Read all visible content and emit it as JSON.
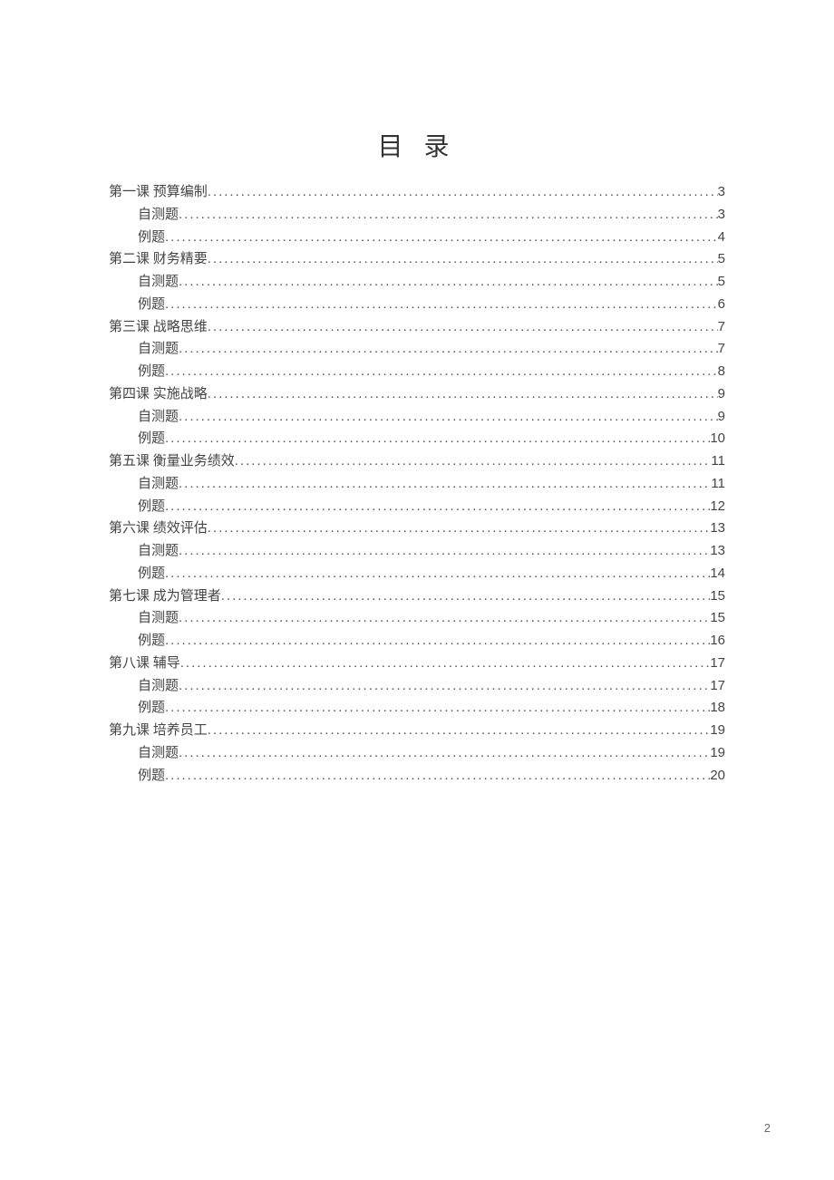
{
  "title": "目 录",
  "page_number": "2",
  "toc": [
    {
      "level": 0,
      "label": "第一课 预算编制",
      "page": "3"
    },
    {
      "level": 1,
      "label": "自测题",
      "page": "3"
    },
    {
      "level": 1,
      "label": "例题",
      "page": "4"
    },
    {
      "level": 0,
      "label": "第二课 财务精要",
      "page": "5"
    },
    {
      "level": 1,
      "label": "自测题",
      "page": "5"
    },
    {
      "level": 1,
      "label": "例题",
      "page": "6"
    },
    {
      "level": 0,
      "label": "第三课 战略思维",
      "page": "7"
    },
    {
      "level": 1,
      "label": "自测题",
      "page": "7"
    },
    {
      "level": 1,
      "label": "例题",
      "page": "8"
    },
    {
      "level": 0,
      "label": "第四课 实施战略",
      "page": "9"
    },
    {
      "level": 1,
      "label": "自测题",
      "page": "9"
    },
    {
      "level": 1,
      "label": "例题",
      "page": "10"
    },
    {
      "level": 0,
      "label": "第五课 衡量业务绩效",
      "page": "11"
    },
    {
      "level": 1,
      "label": "自测题",
      "page": "11"
    },
    {
      "level": 1,
      "label": "例题",
      "page": "12"
    },
    {
      "level": 0,
      "label": "第六课 绩效评估",
      "page": "13"
    },
    {
      "level": 1,
      "label": "自测题",
      "page": "13"
    },
    {
      "level": 1,
      "label": "例题",
      "page": "14"
    },
    {
      "level": 0,
      "label": "第七课 成为管理者",
      "page": "15"
    },
    {
      "level": 1,
      "label": "自测题",
      "page": "15"
    },
    {
      "level": 1,
      "label": "例题",
      "page": "16"
    },
    {
      "level": 0,
      "label": "第八课 辅导",
      "page": "17"
    },
    {
      "level": 1,
      "label": "自测题",
      "page": "17"
    },
    {
      "level": 1,
      "label": "例题",
      "page": "18"
    },
    {
      "level": 0,
      "label": "第九课 培养员工",
      "page": "19"
    },
    {
      "level": 1,
      "label": "自测题",
      "page": "19"
    },
    {
      "level": 1,
      "label": "例题",
      "page": "20"
    }
  ]
}
